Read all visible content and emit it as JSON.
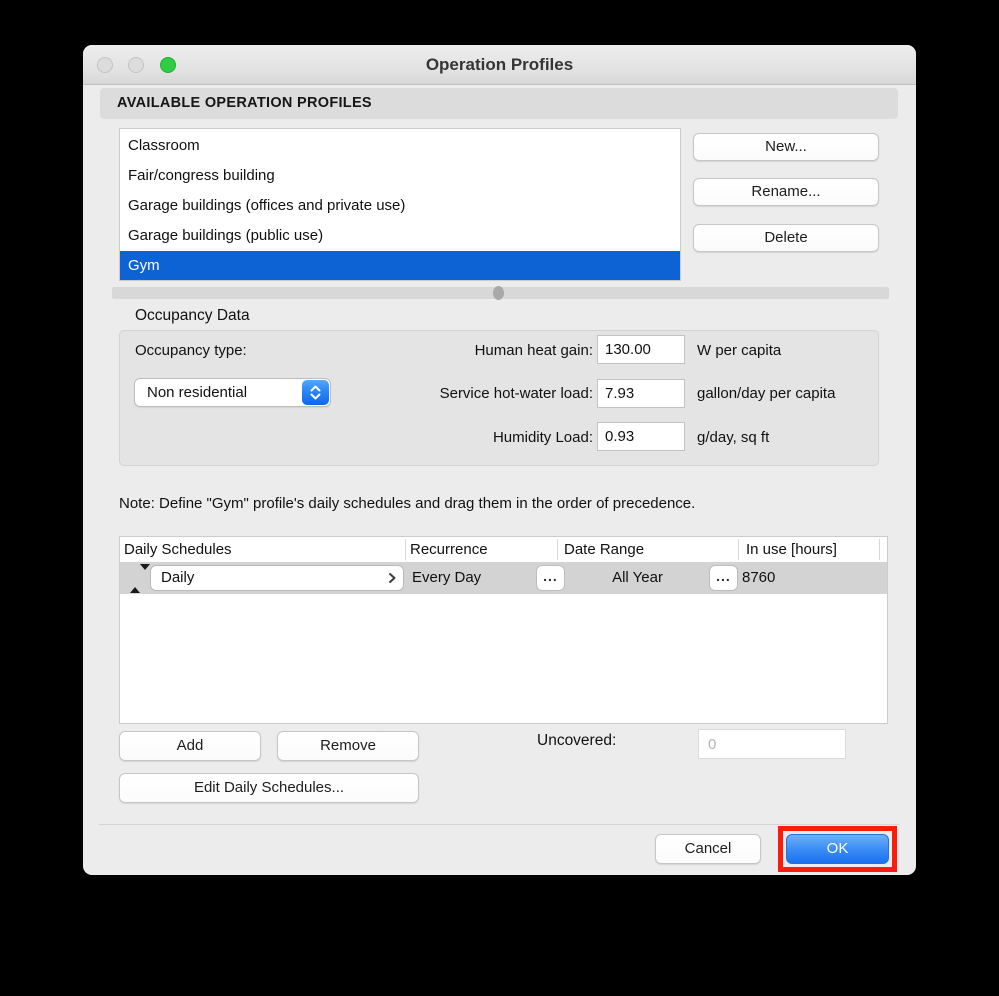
{
  "window": {
    "title": "Operation Profiles"
  },
  "section_header": "AVAILABLE OPERATION PROFILES",
  "profiles": {
    "items": [
      "Classroom",
      "Fair/congress building",
      "Garage buildings (offices and private use)",
      "Garage buildings (public use)",
      "Gym"
    ],
    "selected": "Gym",
    "selected_index": 4
  },
  "profile_actions": {
    "new": "New...",
    "rename": "Rename...",
    "delete": "Delete"
  },
  "occupancy": {
    "title": "Occupancy Data",
    "type_label": "Occupancy type:",
    "type_value": "Non residential",
    "fields": [
      {
        "label": "Human heat gain:",
        "value": "130.00",
        "unit": "W per capita"
      },
      {
        "label": "Service hot-water load:",
        "value": "7.93",
        "unit": "gallon/day per capita"
      },
      {
        "label": "Humidity Load:",
        "value": "0.93",
        "unit": "g/day, sq ft"
      }
    ]
  },
  "note": "Note: Define \"Gym\" profile's daily schedules and drag them in the order of precedence.",
  "schedules": {
    "headers": [
      "Daily Schedules",
      "Recurrence",
      "Date Range",
      "In use [hours]"
    ],
    "row": {
      "schedule": "Daily",
      "recurrence": "Every Day",
      "date_range": "All Year",
      "in_use_hours": "8760"
    },
    "more_label": "...",
    "add": "Add",
    "remove": "Remove",
    "edit": "Edit Daily Schedules...",
    "uncovered_label": "Uncovered:",
    "uncovered_placeholder": "0"
  },
  "footer": {
    "cancel": "Cancel",
    "ok": "OK"
  },
  "colors": {
    "selection_blue": "#0d63d3",
    "ok_button_blue": "#1a71f1",
    "popup_stepper_blue": "#1672f0",
    "annotation_red": "#fb1c0c",
    "traffic_light_green": "#2fcd42",
    "window_background": "#ececec"
  }
}
